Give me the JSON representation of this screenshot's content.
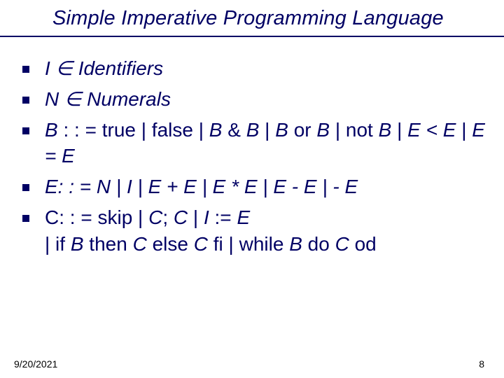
{
  "title": "Simple Imperative Programming Language",
  "bullets": {
    "b0": "I ∈ Identifiers",
    "b1": "N ∈ Numerals",
    "b2_pre": "B",
    "b2_mid1": " : : = true | false | ",
    "b2_it1": "B",
    "b2_mid2": " & ",
    "b2_it2": "B",
    "b2_mid3": " | ",
    "b2_it3": "B",
    "b2_mid4": " or ",
    "b2_it4": "B",
    "b2_mid5": " | not ",
    "b2_it5": "B",
    "b2_mid6": "  | ",
    "b2_it6": "E < E",
    "b2_mid7": " | ",
    "b2_it7": "E = E",
    "b3": "E: : = N | I | E + E | E * E | E - E | - E",
    "b4_pre": "C: : = skip | ",
    "b4_it1": "C",
    "b4_semi": "; ",
    "b4_it2": "C",
    "b4_mid1": " | ",
    "b4_it3": "I",
    "b4_mid2": " := ",
    "b4_it4": "E",
    "b4_br": "| if ",
    "b4_it5": "B",
    "b4_mid3": " then ",
    "b4_it6": "C",
    "b4_mid4": " else ",
    "b4_it7": "C",
    "b4_mid5": " fi | while ",
    "b4_it8": "B",
    "b4_mid6": " do ",
    "b4_it9": "C",
    "b4_mid7": " od"
  },
  "footer": {
    "date": "9/20/2021",
    "page": "8"
  }
}
